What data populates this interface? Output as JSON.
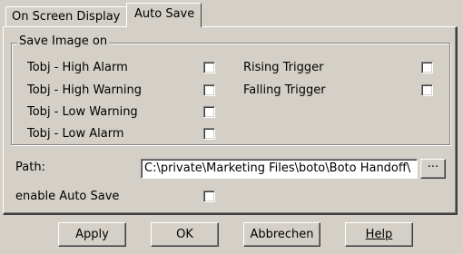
{
  "tabs": [
    {
      "label": "On Screen Display",
      "active": false
    },
    {
      "label": "Auto Save",
      "active": true
    }
  ],
  "save_group": {
    "title": "Save Image on",
    "options_left": [
      {
        "label": "Tobj - High Alarm",
        "checked": false
      },
      {
        "label": "Tobj - High Warning",
        "checked": false
      },
      {
        "label": "Tobj - Low Warning",
        "checked": false
      },
      {
        "label": "Tobj - Low Alarm",
        "checked": false
      }
    ],
    "options_right": [
      {
        "label": "Rising Trigger",
        "checked": false
      },
      {
        "label": "Falling Trigger",
        "checked": false
      }
    ]
  },
  "path": {
    "label": "Path:",
    "value": "C:\\private\\Marketing Files\\boto\\Boto Handoff\\",
    "browse_label": "···"
  },
  "auto_save": {
    "label": "enable Auto Save",
    "checked": false
  },
  "buttons": {
    "apply": "Apply",
    "ok": "OK",
    "cancel": "Abbrechen",
    "help": "Help"
  },
  "colors": {
    "dialog_bg": "#d4d0c8",
    "field_bg": "#ffffff"
  }
}
